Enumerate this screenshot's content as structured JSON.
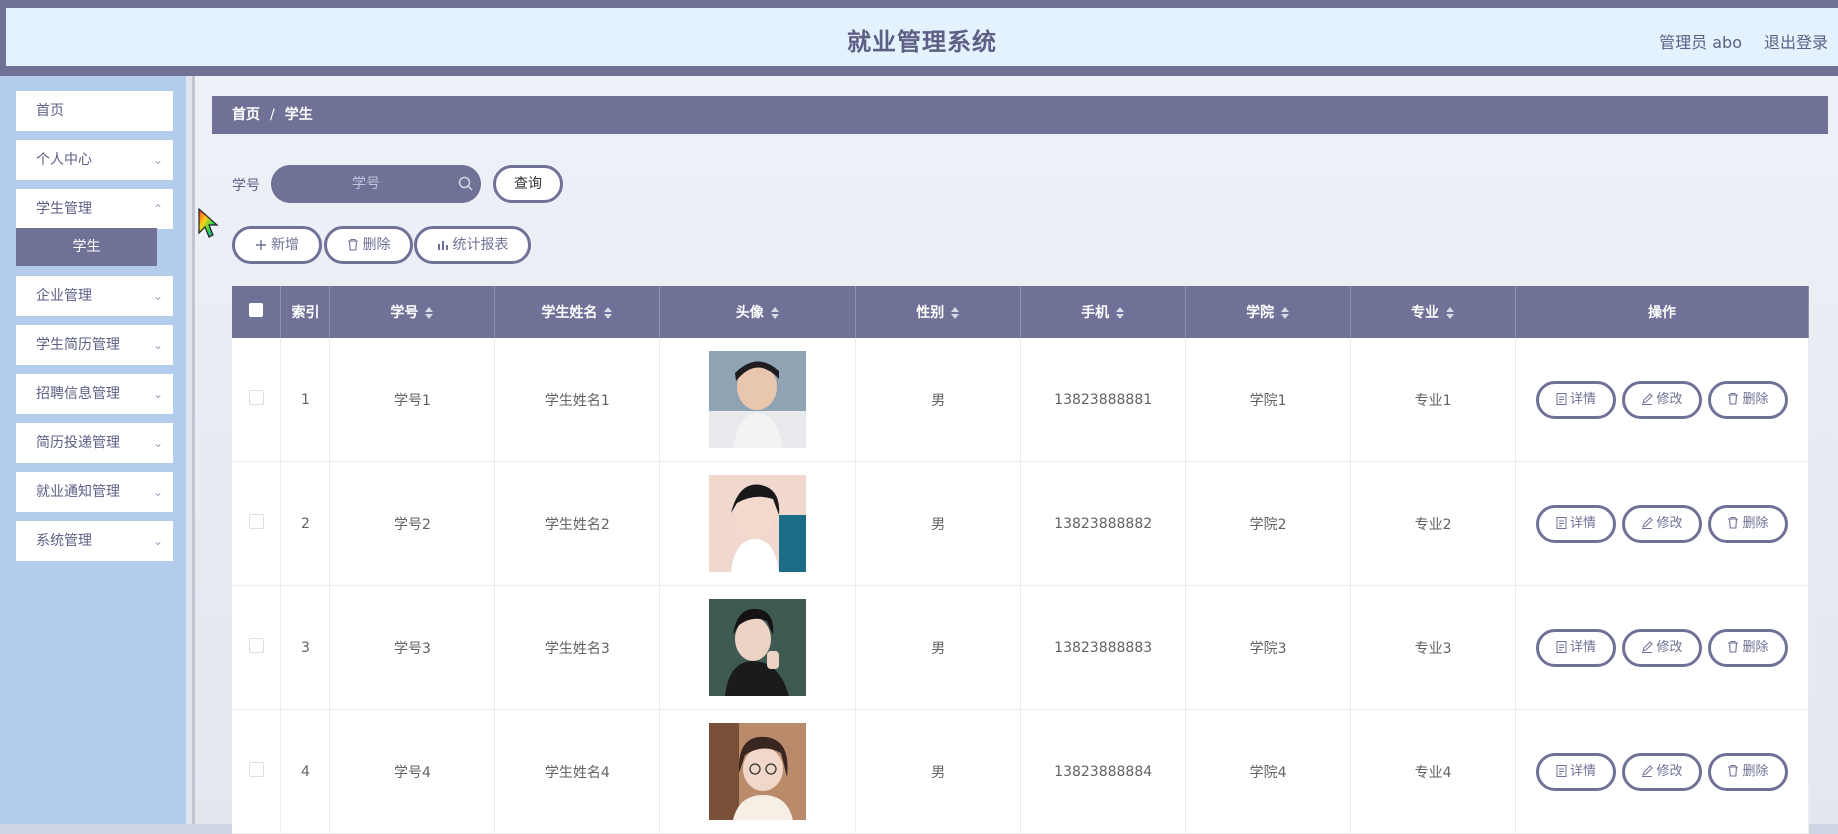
{
  "header": {
    "title": "就业管理系统",
    "user": "管理员 abo",
    "logout": "退出登录"
  },
  "sidebar": {
    "items": [
      {
        "label": "首页",
        "has_children": false
      },
      {
        "label": "个人中心",
        "has_children": true
      },
      {
        "label": "学生管理",
        "has_children": true
      },
      {
        "label": "企业管理",
        "has_children": true
      },
      {
        "label": "学生简历管理",
        "has_children": true
      },
      {
        "label": "招聘信息管理",
        "has_children": true
      },
      {
        "label": "简历投递管理",
        "has_children": true
      },
      {
        "label": "就业通知管理",
        "has_children": true
      },
      {
        "label": "系统管理",
        "has_children": true
      }
    ],
    "active_sub": "学生"
  },
  "breadcrumb": {
    "home": "首页",
    "sep": "/",
    "current": "学生"
  },
  "search": {
    "label": "学号",
    "placeholder": "学号",
    "button": "查询"
  },
  "toolbar": {
    "add": "新增",
    "delete": "删除",
    "report": "统计报表"
  },
  "table": {
    "headers": [
      "索引",
      "学号",
      "学生姓名",
      "头像",
      "性别",
      "手机",
      "学院",
      "专业",
      "操作"
    ],
    "rows": [
      {
        "index": "1",
        "student_no": "学号1",
        "name": "学生姓名1",
        "gender": "男",
        "phone": "13823888881",
        "college": "学院1",
        "major": "专业1"
      },
      {
        "index": "2",
        "student_no": "学号2",
        "name": "学生姓名2",
        "gender": "男",
        "phone": "13823888882",
        "college": "学院2",
        "major": "专业2"
      },
      {
        "index": "3",
        "student_no": "学号3",
        "name": "学生姓名3",
        "gender": "男",
        "phone": "13823888883",
        "college": "学院3",
        "major": "专业3"
      },
      {
        "index": "4",
        "student_no": "学号4",
        "name": "学生姓名4",
        "gender": "男",
        "phone": "13823888884",
        "college": "学院4",
        "major": "专业4"
      }
    ],
    "actions": {
      "detail": "详情",
      "edit": "修改",
      "delete": "删除"
    }
  },
  "colors": {
    "primary": "#6f7196",
    "sidebar_bg": "#b4cdec",
    "header_bg": "#e4f2fd"
  }
}
